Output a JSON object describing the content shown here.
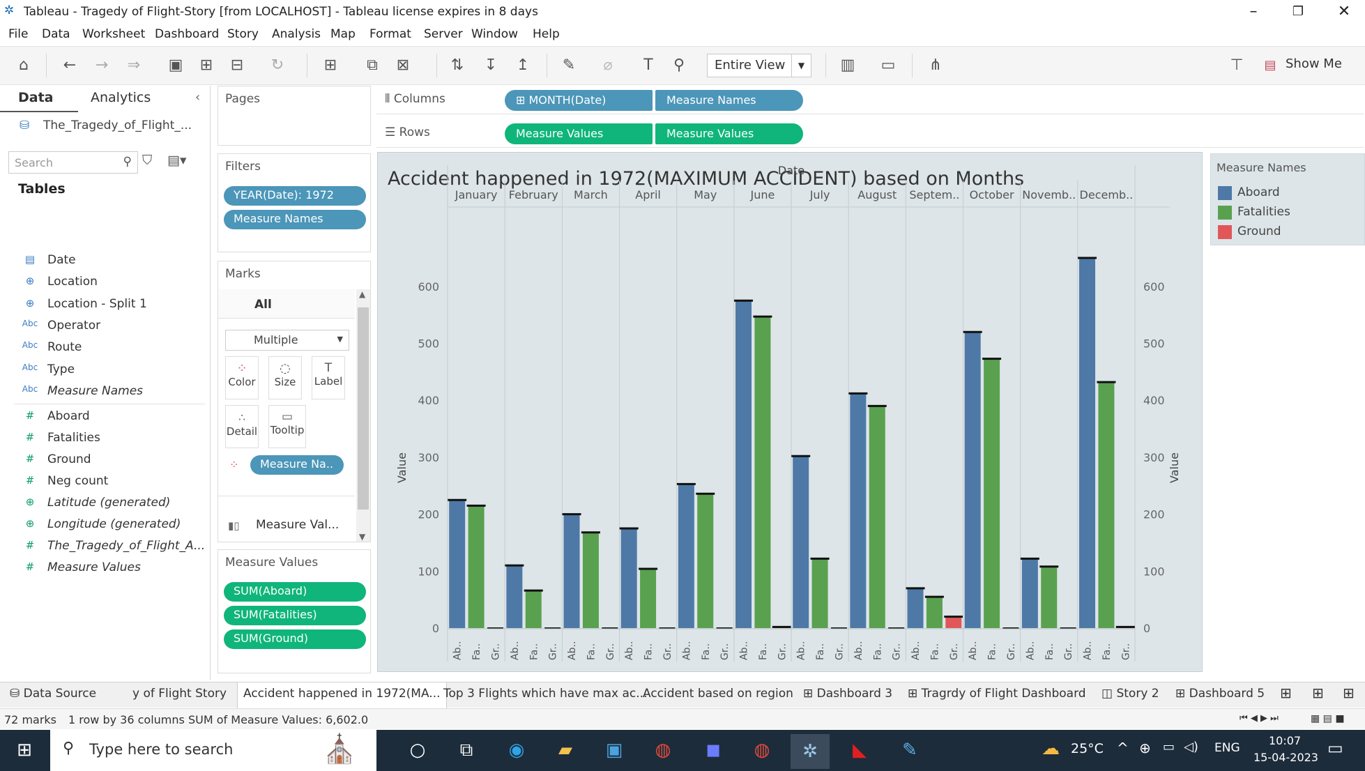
{
  "window": {
    "title": "Tableau - Tragedy of Flight-Story [from LOCALHOST] - Tableau license expires in 8 days"
  },
  "menu": [
    "File",
    "Data",
    "Worksheet",
    "Dashboard",
    "Story",
    "Analysis",
    "Map",
    "Format",
    "Server",
    "Window",
    "Help"
  ],
  "toolbar": {
    "fit": "Entire View",
    "show_me": "Show Me"
  },
  "data_pane": {
    "tabs": [
      "Data",
      "Analytics"
    ],
    "source": "The_Tragedy_of_Flight_...",
    "search_placeholder": "Search",
    "tables_header": "Tables",
    "fields": [
      {
        "icon": "calendar-icon",
        "glyph": "▤",
        "name": "Date",
        "kind": "dim",
        "italic": false
      },
      {
        "icon": "globe-icon",
        "glyph": "⊕",
        "name": "Location",
        "kind": "dim",
        "italic": false
      },
      {
        "icon": "globe-icon",
        "glyph": "⊕",
        "name": "Location - Split 1",
        "kind": "dim",
        "italic": false
      },
      {
        "icon": "text-type-icon",
        "glyph": "Abc",
        "name": "Operator",
        "kind": "dim",
        "italic": false
      },
      {
        "icon": "text-type-icon",
        "glyph": "Abc",
        "name": "Route",
        "kind": "dim",
        "italic": false
      },
      {
        "icon": "text-type-icon",
        "glyph": "Abc",
        "name": "Type",
        "kind": "dim",
        "italic": false
      },
      {
        "icon": "text-type-icon",
        "glyph": "Abc",
        "name": "Measure Names",
        "kind": "dim",
        "italic": true
      },
      {
        "icon": "number-type-icon",
        "glyph": "#",
        "name": "Aboard",
        "kind": "mea",
        "italic": false
      },
      {
        "icon": "number-type-icon",
        "glyph": "#",
        "name": "Fatalities",
        "kind": "mea",
        "italic": false
      },
      {
        "icon": "number-type-icon",
        "glyph": "#",
        "name": "Ground",
        "kind": "mea",
        "italic": false
      },
      {
        "icon": "number-type-icon",
        "glyph": "#",
        "name": "Neg count",
        "kind": "mea",
        "italic": false
      },
      {
        "icon": "globe-icon",
        "glyph": "⊕",
        "name": "Latitude (generated)",
        "kind": "mea",
        "italic": true
      },
      {
        "icon": "globe-icon",
        "glyph": "⊕",
        "name": "Longitude (generated)",
        "kind": "mea",
        "italic": true
      },
      {
        "icon": "number-type-icon",
        "glyph": "#",
        "name": "The_Tragedy_of_Flight_A...",
        "kind": "mea",
        "italic": true
      },
      {
        "icon": "number-type-icon",
        "glyph": "#",
        "name": "Measure Values",
        "kind": "mea",
        "italic": true
      }
    ]
  },
  "pages": {
    "title": "Pages"
  },
  "filters": {
    "title": "Filters",
    "pills": [
      "YEAR(Date): 1972",
      "Measure Names"
    ]
  },
  "marks": {
    "title": "Marks",
    "all": "All",
    "type": "Multiple",
    "buttons": [
      "Color",
      "Size",
      "Label",
      "Detail",
      "Tooltip"
    ],
    "color_pill": "Measure Na..",
    "measure_row": "Measure Val..."
  },
  "measure_values": {
    "title": "Measure Values",
    "pills": [
      "SUM(Aboard)",
      "SUM(Fatalities)",
      "SUM(Ground)"
    ]
  },
  "shelves": {
    "columns_label": "Columns",
    "columns": [
      "MONTH(Date)",
      "Measure Names"
    ],
    "rows_label": "Rows",
    "rows": [
      "Measure Values",
      "Measure Values"
    ]
  },
  "legend": {
    "title": "Measure Names",
    "items": [
      {
        "name": "Aboard",
        "color": "#4e79a7"
      },
      {
        "name": "Fatalities",
        "color": "#59a14f"
      },
      {
        "name": "Ground",
        "color": "#e15759"
      }
    ]
  },
  "chart_data": {
    "type": "bar",
    "title": "Accident happened in 1972(MAXIMUM ACCIDENT) based on Months",
    "xlabel": "Date",
    "ylabel": "Value",
    "ylabel_right": "Value",
    "ylim": [
      0,
      650
    ],
    "yticks": [
      0,
      100,
      200,
      300,
      400,
      500,
      600
    ],
    "grid": false,
    "month_labels": [
      "January",
      "February",
      "March",
      "April",
      "May",
      "June",
      "July",
      "August",
      "Septem..",
      "October",
      "Novemb..",
      "Decemb.."
    ],
    "sub_labels": [
      "Ab..",
      "Fa..",
      "Gr.."
    ],
    "series": [
      {
        "name": "Aboard",
        "color": "#4e79a7",
        "values": [
          225,
          110,
          200,
          175,
          253,
          575,
          302,
          412,
          70,
          520,
          122,
          650
        ]
      },
      {
        "name": "Fatalities",
        "color": "#59a14f",
        "values": [
          215,
          66,
          168,
          104,
          236,
          547,
          122,
          390,
          55,
          473,
          108,
          432
        ]
      },
      {
        "name": "Ground",
        "color": "#e15759",
        "values": [
          0,
          0,
          0,
          0,
          0,
          2,
          0,
          0,
          20,
          0,
          0,
          2
        ]
      }
    ]
  },
  "sheet_tabs": [
    {
      "label": "Data Source",
      "active": false
    },
    {
      "label": "y of Flight Story",
      "active": false
    },
    {
      "label": "Accident happened in 1972(MA...",
      "active": true
    },
    {
      "label": "Top 3 Flights which have max ac...",
      "active": false
    },
    {
      "label": "Accident based on region",
      "active": false
    },
    {
      "label": "Dashboard 3",
      "active": false
    },
    {
      "label": "Tragrdy of Flight Dashboard",
      "active": false
    },
    {
      "label": "Story 2",
      "active": false
    },
    {
      "label": "Dashboard 5",
      "active": false
    }
  ],
  "status": {
    "marks": "72 marks",
    "dims": "1 row by 36 columns",
    "sum": "SUM of Measure Values: 6,602.0"
  },
  "taskbar": {
    "search": "Type here to search",
    "temp": "25°C",
    "lang": "ENG",
    "time": "10:07",
    "date": "15-04-2023"
  }
}
